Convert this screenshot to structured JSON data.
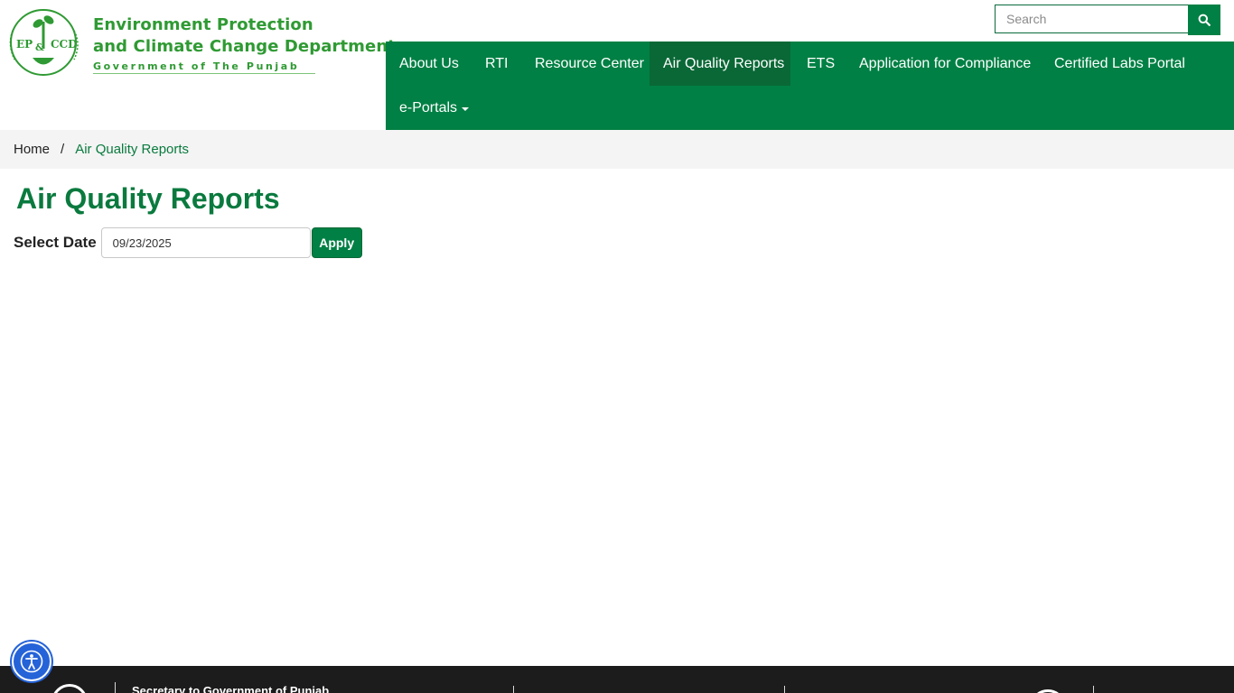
{
  "header": {
    "logo_emblem_text": "EP&CCD",
    "logo_line1": "Environment Protection",
    "logo_line2": "and Climate Change Department",
    "logo_line3": "Government of The Punjab"
  },
  "search": {
    "placeholder": "Search",
    "button_icon": "search-icon"
  },
  "nav": {
    "items": [
      {
        "label": "About Us"
      },
      {
        "label": "RTI"
      },
      {
        "label": "Resource Center"
      },
      {
        "label": "Air Quality Reports"
      },
      {
        "label": "ETS"
      },
      {
        "label": "Application for Compliance"
      },
      {
        "label": "Certified Labs Portal"
      },
      {
        "label": "e-Portals"
      }
    ],
    "active": "Air Quality Reports"
  },
  "breadcrumb": {
    "home": "Home",
    "separator": "/",
    "current": "Air Quality Reports"
  },
  "page": {
    "title": "Air Quality Reports",
    "date_label": "Select Date",
    "date_value": "09/23/2025",
    "apply_label": "Apply"
  },
  "footer": {
    "text": "Secretary to Government of Punjab"
  },
  "accessibility": {
    "icon": "accessibility-icon"
  },
  "colors": {
    "primary_green": "#008044",
    "active_green": "#0a6836",
    "title_green": "#0a7a3e",
    "logo_green": "#2f9a33",
    "footer_bg": "#1c1c1c",
    "a11y_blue": "#2563d8"
  }
}
